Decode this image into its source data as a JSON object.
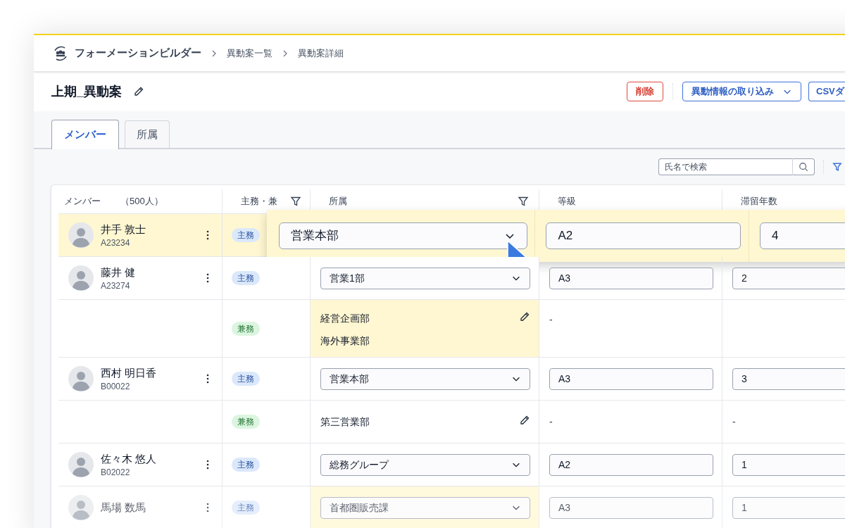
{
  "breadcrumbs": [
    "フォーメーションビルダー",
    "異動案一覧",
    "異動案詳細"
  ],
  "title": "上期_異動案",
  "actions": [
    {
      "label": "削除",
      "kind": "danger"
    },
    {
      "label": "異動情報の取り込み",
      "kind": "dropdown"
    },
    {
      "label": "CSVダ",
      "kind": "primary"
    }
  ],
  "tabs": [
    {
      "label": "メンバー",
      "selected": true
    },
    {
      "label": "所属",
      "selected": false
    }
  ],
  "search": {
    "placeholder": "氏名で検索"
  },
  "table": {
    "columns": [
      {
        "label": "メンバー",
        "count": "（500人）",
        "filter": false
      },
      {
        "label": "主務・兼",
        "filter": true
      },
      {
        "label": "所属",
        "filter": true
      },
      {
        "label": "等級",
        "filter": false
      },
      {
        "label": "滞留年数",
        "filter": false
      }
    ],
    "rows": [
      {
        "name": "井手 敦士",
        "code": "A23234",
        "role": {
          "kind": "main",
          "label": "主務"
        },
        "affiliation": {
          "kind": "select",
          "values": [
            "営業本部"
          ]
        },
        "grade": {
          "kind": "input",
          "value": "A2"
        },
        "years": {
          "kind": "input",
          "value": "4"
        },
        "editing": true,
        "highlighted": false,
        "faded": false
      },
      {
        "name": "藤井 健",
        "code": "A23274",
        "role": {
          "kind": "main",
          "label": "主務"
        },
        "affiliation": {
          "kind": "select",
          "values": [
            "営業1部"
          ]
        },
        "grade": {
          "kind": "input",
          "value": "A3"
        },
        "years": {
          "kind": "input",
          "value": "2"
        },
        "editing": false,
        "highlighted": false,
        "faded": false
      },
      {
        "role": {
          "kind": "side",
          "label": "兼務"
        },
        "affiliation": {
          "kind": "text",
          "values": [
            "経営企画部",
            "海外事業部"
          ]
        },
        "grade": {
          "kind": "text",
          "value": "-"
        },
        "editing": false,
        "highlighted": true,
        "faded": false
      },
      {
        "name": "西村 明日香",
        "code": "B00022",
        "role": {
          "kind": "main",
          "label": "主務"
        },
        "affiliation": {
          "kind": "select",
          "values": [
            "営業本部"
          ]
        },
        "grade": {
          "kind": "input",
          "value": "A3"
        },
        "years": {
          "kind": "input",
          "value": "3"
        },
        "editing": false,
        "highlighted": false,
        "faded": false
      },
      {
        "role": {
          "kind": "side",
          "label": "兼務"
        },
        "affiliation": {
          "kind": "text",
          "values": [
            "第三営業部"
          ]
        },
        "grade": {
          "kind": "text",
          "value": "-"
        },
        "years": {
          "kind": "text",
          "value": "-"
        },
        "editing": false,
        "highlighted": false,
        "faded": false
      },
      {
        "name": "佐々木 悠人",
        "code": "B02022",
        "role": {
          "kind": "main",
          "label": "主務"
        },
        "affiliation": {
          "kind": "select",
          "values": [
            "総務グループ"
          ]
        },
        "grade": {
          "kind": "input",
          "value": "A2"
        },
        "years": {
          "kind": "input",
          "value": "1"
        },
        "editing": false,
        "highlighted": false,
        "faded": false
      },
      {
        "name": "馬場 数馬",
        "role": {
          "kind": "main",
          "label": "主務"
        },
        "affiliation": {
          "kind": "select",
          "values": [
            "首都圏販売課"
          ]
        },
        "grade": {
          "kind": "input",
          "value": "A3"
        },
        "years": {
          "kind": "input",
          "value": "1"
        },
        "editing": false,
        "highlighted": true,
        "faded": true
      }
    ]
  }
}
